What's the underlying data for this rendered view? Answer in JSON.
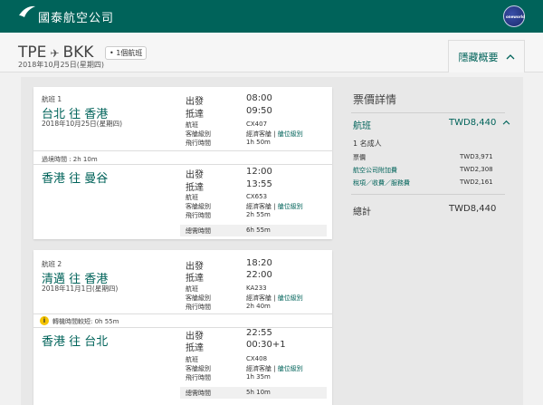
{
  "brand": {
    "name": "國泰航空公司",
    "badge": "oneworld"
  },
  "header": {
    "origin": "TPE",
    "destination": "BKK",
    "stops": "• 1個航班",
    "date": "2018年10月25日(星期四)",
    "toggle_label": "隱藏概要"
  },
  "flights": [
    {
      "tag": "航班 1",
      "route": "台北 往 香港",
      "date": "2018年10月25日(星期四)",
      "segments": [
        {
          "city": "台北 往 香港",
          "depart_label": "出發",
          "depart": "08:00",
          "arrive_label": "抵達",
          "arrive": "09:50",
          "flight_label": "航班",
          "flight": "CX407",
          "cabin_label": "客艙級別",
          "cabin": "經濟客艙",
          "class_link": "艙位級別",
          "duration_label": "飛行時間",
          "duration": "1h 50m"
        },
        {
          "city": "香港 往 曼谷",
          "depart_label": "出發",
          "depart": "12:00",
          "arrive_label": "抵達",
          "arrive": "13:55",
          "flight_label": "航班",
          "flight": "CX653",
          "cabin_label": "客艙級別",
          "cabin": "經濟客艙",
          "class_link": "艙位級別",
          "duration_label": "飛行時間",
          "duration": "2h 55m"
        }
      ],
      "connection": "過境時間 : 2h 10m",
      "total_label": "總需時間",
      "total": "6h 55m"
    },
    {
      "tag": "航班 2",
      "route": "清邁 往 香港",
      "date": "2018年11月1日(星期四)",
      "segments": [
        {
          "city": "清邁 往 香港",
          "depart_label": "出發",
          "depart": "18:20",
          "arrive_label": "抵達",
          "arrive": "22:00",
          "flight_label": "航班",
          "flight": "KA233",
          "cabin_label": "客艙級別",
          "cabin": "經濟客艙",
          "class_link": "艙位級別",
          "duration_label": "飛行時間",
          "duration": "2h 40m"
        },
        {
          "city": "香港 往 台北",
          "depart_label": "出發",
          "depart": "22:55",
          "arrive_label": "抵達",
          "arrive": "00:30+1",
          "flight_label": "航班",
          "flight": "CX408",
          "cabin_label": "客艙級別",
          "cabin": "經濟客艙",
          "class_link": "艙位級別",
          "duration_label": "飛行時間",
          "duration": "1h 35m"
        }
      ],
      "connection": "轉機時間較短: 0h 55m",
      "total_label": "總需時間",
      "total": "5h 10m"
    }
  ],
  "fare": {
    "title": "票價詳情",
    "flight_label": "航班",
    "flight_amount": "TWD8,440",
    "passengers": "1 名成人",
    "items": [
      {
        "label": "票價",
        "amount": "TWD3,971",
        "link": false
      },
      {
        "label": "航空公司附加費",
        "amount": "TWD2,308",
        "link": true
      },
      {
        "label": "稅項／收費／服務費",
        "amount": "TWD2,161",
        "link": true
      }
    ],
    "total_label": "總計",
    "total_amount": "TWD8,440"
  },
  "colors": {
    "brand": "#00635a",
    "alert": "#f5c400"
  }
}
